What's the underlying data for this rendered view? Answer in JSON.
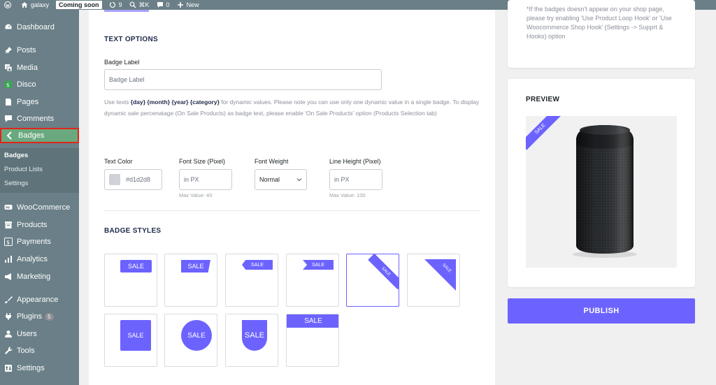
{
  "adminbar": {
    "site_name": "galaxy",
    "coming_soon": "Coming soon",
    "updates_count": "9",
    "shortcut": "⌘K",
    "comments_count": "0",
    "new_label": "New"
  },
  "sidebar": {
    "items": [
      {
        "label": "Dashboard",
        "icon": "dashboard-icon"
      },
      {
        "label": "Posts",
        "icon": "pin-icon"
      },
      {
        "label": "Media",
        "icon": "media-icon"
      },
      {
        "label": "Disco",
        "icon": "disco-icon"
      },
      {
        "label": "Pages",
        "icon": "page-icon"
      },
      {
        "label": "Comments",
        "icon": "comment-icon"
      },
      {
        "label": "Badges",
        "icon": "chevron-left-icon"
      },
      {
        "label": "WooCommerce",
        "icon": "woo-icon"
      },
      {
        "label": "Products",
        "icon": "archive-icon"
      },
      {
        "label": "Payments",
        "icon": "dollar-icon"
      },
      {
        "label": "Analytics",
        "icon": "bar-chart-icon"
      },
      {
        "label": "Marketing",
        "icon": "megaphone-icon"
      },
      {
        "label": "Appearance",
        "icon": "brush-icon"
      },
      {
        "label": "Plugins",
        "icon": "plug-icon"
      },
      {
        "label": "Users",
        "icon": "user-icon"
      },
      {
        "label": "Tools",
        "icon": "wrench-icon"
      },
      {
        "label": "Settings",
        "icon": "settings-icon"
      }
    ],
    "plugins_count": "5",
    "submenu": [
      "Badges",
      "Product Lists",
      "Settings"
    ]
  },
  "text_options": {
    "heading": "TEXT OPTIONS",
    "badge_label_title": "Badge Label",
    "badge_label_placeholder": "Badge Label",
    "help_1": "Use texts ",
    "help_tokens": "{day} {month} {year} {category}",
    "help_2": " for dynamic values. Please note you can use only one dynamic value in a single badge. To display dynamic sale percenatage (On Sale Products) as badge text, please enable 'On Sale Products' option (Products Selection tab)",
    "text_color_label": "Text Color",
    "text_color_value": "#d1d2d8",
    "font_size_label": "Font Size (Pixel)",
    "font_size_placeholder": "in PX",
    "font_size_hint": "Max Value: 40",
    "font_weight_label": "Font Weight",
    "font_weight_value": "Normal",
    "line_height_label": "Line Height (Pixel)",
    "line_height_placeholder": "in PX",
    "line_height_hint": "Max Value: 100"
  },
  "badge_styles": {
    "heading": "BADGE STYLES",
    "sale_text": "SALE",
    "selected_index": 4,
    "accent": "#6c63ff"
  },
  "right": {
    "note": "*If the badges doesn't appear on your shop page, please try enabling 'Use Product Loop Hook' or 'Use Woocommerce Shop Hook' (Settings -> Supprt & Hooks) option",
    "preview_title": "PREVIEW",
    "preview_badge": "SALE",
    "publish_label": "PUBLISH"
  }
}
